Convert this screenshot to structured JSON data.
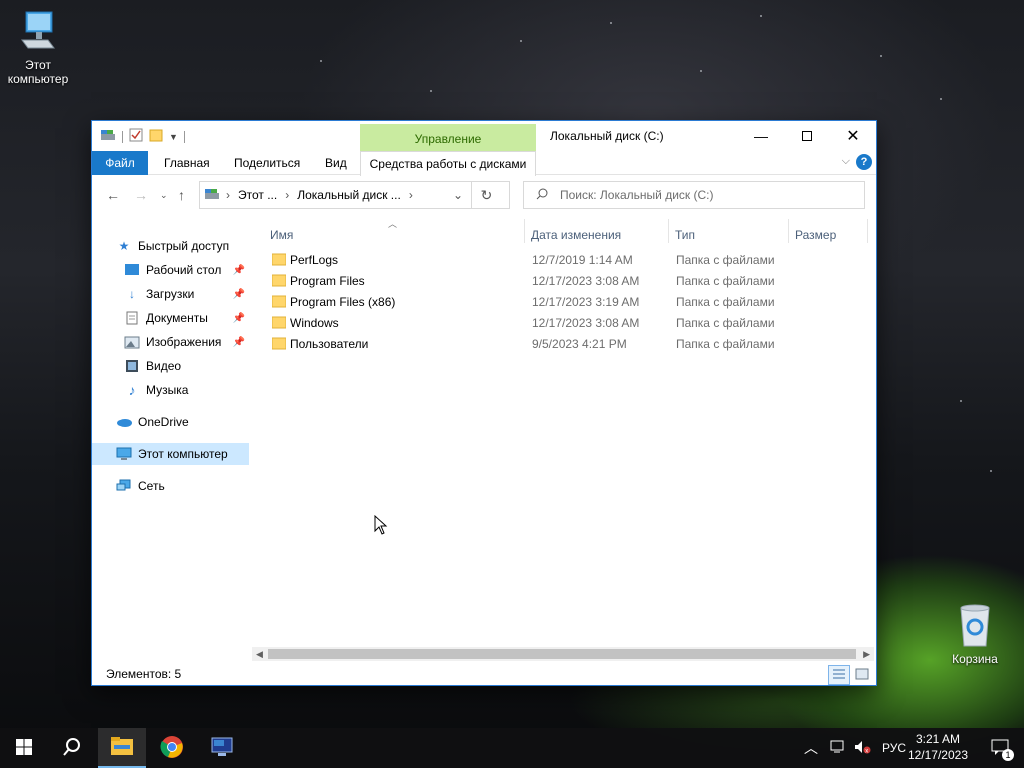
{
  "desktop": {
    "icons": [
      {
        "label_line1": "Этот",
        "label_line2": "компьютер"
      },
      {
        "label_line1": "Корзина"
      }
    ]
  },
  "window": {
    "title": "Локальный диск (C:)",
    "context_tab_group": "Управление",
    "ribbon_tabs": {
      "file": "Файл",
      "home": "Главная",
      "share": "Поделиться",
      "view": "Вид",
      "drive_tools": "Средства работы с дисками"
    },
    "address": {
      "crumb1": "Этот ...",
      "crumb2": "Локальный диск ..."
    },
    "search_placeholder": "Поиск: Локальный диск (C:)",
    "nav_pane": {
      "quick_access": "Быстрый доступ",
      "desktop": "Рабочий стол",
      "downloads": "Загрузки",
      "documents": "Документы",
      "pictures": "Изображения",
      "videos": "Видео",
      "music": "Музыка",
      "onedrive": "OneDrive",
      "this_pc": "Этот компьютер",
      "network": "Сеть"
    },
    "columns": {
      "name": "Имя",
      "date": "Дата изменения",
      "type": "Тип",
      "size": "Размер"
    },
    "files": [
      {
        "name": "PerfLogs",
        "date": "12/7/2019 1:14 AM",
        "type": "Папка с файлами"
      },
      {
        "name": "Program Files",
        "date": "12/17/2023 3:08 AM",
        "type": "Папка с файлами"
      },
      {
        "name": "Program Files (x86)",
        "date": "12/17/2023 3:19 AM",
        "type": "Папка с файлами"
      },
      {
        "name": "Windows",
        "date": "12/17/2023 3:08 AM",
        "type": "Папка с файлами"
      },
      {
        "name": "Пользователи",
        "date": "9/5/2023 4:21 PM",
        "type": "Папка с файлами"
      }
    ],
    "status": "Элементов: 5"
  },
  "taskbar": {
    "language": "РУС",
    "time": "3:21 AM",
    "date": "12/17/2023",
    "notification_count": "1"
  },
  "colors": {
    "accent": "#1979ca",
    "context_tab": "#c9eba0",
    "selection": "#cce8ff"
  }
}
